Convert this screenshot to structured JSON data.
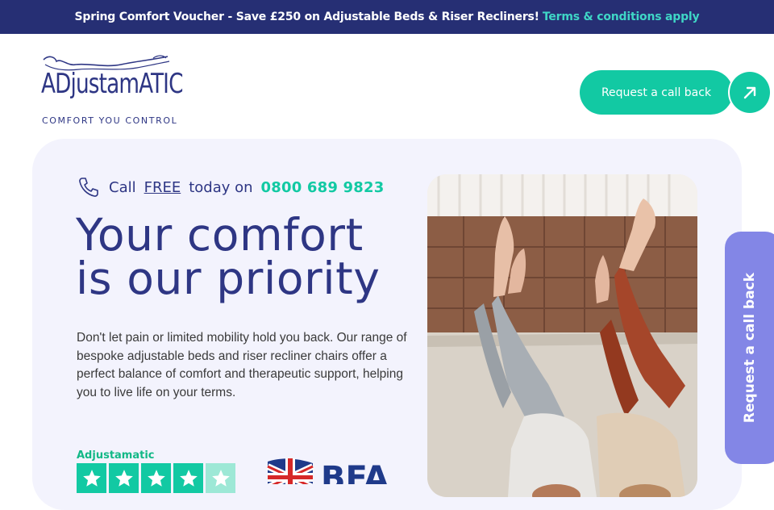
{
  "promo": {
    "text": "Spring Comfort Voucher - Save £250 on Adjustable Beds & Riser Recliners!",
    "terms_link": "Terms & conditions apply"
  },
  "logo": {
    "wordmark": "ADjustamATIC",
    "tagline": "COMFORT YOU CONTROL"
  },
  "header": {
    "cta_label": "Request a call back",
    "cta_icon": "arrow-up-right-icon"
  },
  "hero": {
    "call_prefix": "Call",
    "call_free": "FREE",
    "call_mid": "today on",
    "phone_number": "0800 689 9823",
    "headline_line1": "Your comfort",
    "headline_line2": "is our priority",
    "body": "Don't let pain or limited mobility hold you back. Our range of bespoke adjustable beds and riser recliner chairs offer a perfect balance of comfort and therapeutic support, helping you to live life on your terms."
  },
  "trustpilot": {
    "name": "Adjustamatic",
    "rating": 4.5,
    "stars_total": 5
  },
  "bfa": {
    "label": "BFA"
  },
  "side_tab": {
    "label": "Request a call back"
  },
  "colors": {
    "navy": "#262f74",
    "brand_blue": "#2e3684",
    "teal": "#12c9a3",
    "card_bg": "#f3f3fd",
    "side_tab": "#8386e6"
  }
}
